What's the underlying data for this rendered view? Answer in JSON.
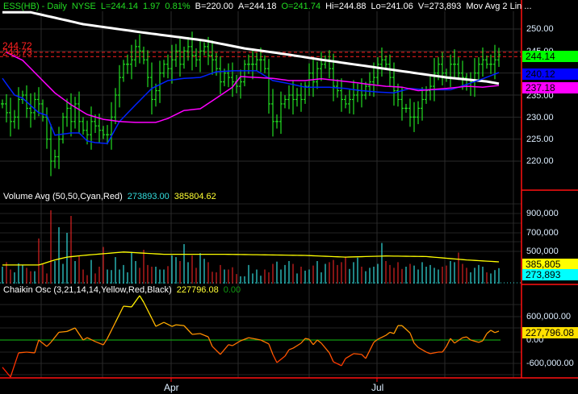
{
  "header": {
    "symbol": "ESS(HB) - Daily",
    "exchange": "NYSE",
    "last": "L=244.14",
    "change": "1.97",
    "change_pct": "0.81%",
    "bid": "B=220.00",
    "ask": "A=244.18",
    "open": "O=241.74",
    "high": "Hi=244.88",
    "low": "Lo=241.06",
    "volume": "V=273,893",
    "studies": "Mov Avg 2 Lin ..."
  },
  "volume_panel": {
    "title": "Volume Avg (50,50,Cyan,Red)",
    "value": "273893.00",
    "avg_value": "385804.62"
  },
  "chaikin_panel": {
    "title": "Chaikin Osc (3,21,14,14,Yellow,Red,Black)",
    "value": "227796.08",
    "signal_value": "0.00"
  },
  "price_axis": {
    "ticks": [
      "250.00",
      "245.00",
      "235.00",
      "230.00",
      "225.00",
      "220.00"
    ]
  },
  "volume_axis": {
    "ticks": [
      "900,000",
      "700,000",
      "500,000"
    ]
  },
  "chaikin_axis": {
    "ticks": [
      "600,000.00",
      "0.00",
      "-600,000.00"
    ]
  },
  "tags": {
    "last": "244.14",
    "ma_blue": "240.12",
    "ma_magenta": "237.18",
    "vol_avg": "385,805",
    "vol": "273,893",
    "chaikin": "227,796.08"
  },
  "ref_lines": {
    "upper": "244.72",
    "lower": "243.73"
  },
  "x_axis": {
    "labels": [
      "Apr",
      "Jul"
    ]
  },
  "colors": {
    "bar": "#22dd22",
    "up_volume": "#33dddd",
    "down_volume": "#dd2222",
    "ma_white": "#ffffff",
    "ma_blue": "#0022ff",
    "ma_magenta": "#ff00ff",
    "ref": "#ff2020",
    "axis": "#ff1010",
    "zero": "#119911",
    "vol_avg": "#ffff00"
  },
  "chart_data": {
    "type": "line",
    "title": "ESS(HB) - Daily NYSE",
    "price_ylim": [
      215,
      254
    ],
    "closes": [
      233,
      231,
      229,
      230,
      234,
      235,
      232,
      231,
      234,
      233,
      230,
      225,
      220,
      221,
      225,
      230,
      232,
      229,
      233,
      229,
      227,
      226,
      229,
      228,
      227,
      226,
      226,
      230,
      235,
      239,
      242,
      242,
      243,
      246,
      245,
      243,
      239,
      234,
      236,
      240,
      242,
      241,
      243,
      245,
      242,
      245,
      246,
      244,
      243,
      245,
      246,
      244,
      243,
      241,
      238,
      240,
      239,
      238,
      237,
      238,
      242,
      242,
      242,
      243,
      243,
      241,
      233,
      229,
      229,
      233,
      234,
      235,
      234,
      235,
      234,
      237,
      240,
      238,
      241,
      242,
      243,
      241,
      237,
      236,
      234,
      233,
      234,
      235,
      236,
      235,
      237,
      238,
      239,
      242,
      243,
      242,
      239,
      236,
      234,
      232,
      232,
      230,
      230,
      232,
      234,
      236,
      237,
      240,
      242,
      240,
      239,
      242,
      242,
      240,
      239,
      237,
      238,
      240,
      242,
      243,
      242,
      242,
      243,
      244.14
    ],
    "ma_white": [
      [
        0,
        253.8
      ],
      [
        7,
        253.8
      ],
      [
        20,
        251.1
      ],
      [
        34,
        249.3
      ],
      [
        50,
        247.4
      ],
      [
        60,
        245.6
      ],
      [
        70,
        244.3
      ],
      [
        80,
        242.9
      ],
      [
        90,
        241.6
      ],
      [
        100,
        240.3
      ],
      [
        110,
        239.0
      ],
      [
        120,
        238.1
      ],
      [
        123,
        237.6
      ]
    ],
    "ma_blue": [
      [
        0,
        238.8
      ],
      [
        3,
        235
      ],
      [
        5,
        234.3
      ],
      [
        9,
        231
      ],
      [
        11,
        230.4
      ],
      [
        13,
        225.9
      ],
      [
        17,
        226.4
      ],
      [
        19,
        226.4
      ],
      [
        21,
        224.6
      ],
      [
        23,
        224.2
      ],
      [
        26,
        224
      ],
      [
        29,
        229
      ],
      [
        33,
        232.8
      ],
      [
        37,
        236.5
      ],
      [
        41,
        238.3
      ],
      [
        45,
        238.8
      ],
      [
        49,
        239
      ],
      [
        53,
        240.3
      ],
      [
        57,
        240.5
      ],
      [
        63,
        240.5
      ],
      [
        67,
        238.3
      ],
      [
        71,
        237.6
      ],
      [
        75,
        236.8
      ],
      [
        81,
        236.8
      ],
      [
        85,
        236.5
      ],
      [
        89,
        236
      ],
      [
        93,
        235.7
      ],
      [
        97,
        235.5
      ],
      [
        101,
        236.5
      ],
      [
        105,
        236.2
      ],
      [
        111,
        236.2
      ],
      [
        115,
        237.4
      ],
      [
        119,
        238.7
      ],
      [
        123,
        240.12
      ]
    ],
    "ma_magenta": [
      [
        1,
        244.7
      ],
      [
        5,
        242.9
      ],
      [
        9,
        239.2
      ],
      [
        13,
        235.5
      ],
      [
        17,
        232.8
      ],
      [
        21,
        230.6
      ],
      [
        25,
        229.5
      ],
      [
        29,
        229
      ],
      [
        33,
        228.8
      ],
      [
        38,
        228.8
      ],
      [
        41,
        229.7
      ],
      [
        45,
        231.5
      ],
      [
        49,
        231.9
      ],
      [
        53,
        234.3
      ],
      [
        57,
        236.8
      ],
      [
        59,
        239.2
      ],
      [
        63,
        239
      ],
      [
        67,
        238.8
      ],
      [
        71,
        238.3
      ],
      [
        75,
        238.3
      ],
      [
        79,
        238.7
      ],
      [
        83,
        238.3
      ],
      [
        87,
        237.9
      ],
      [
        91,
        237.4
      ],
      [
        95,
        237
      ],
      [
        99,
        236.8
      ],
      [
        103,
        236
      ],
      [
        107,
        236.3
      ],
      [
        111,
        236.6
      ],
      [
        115,
        237
      ],
      [
        119,
        236.8
      ],
      [
        123,
        237.18
      ]
    ],
    "volume_thousands": [
      300,
      380,
      250,
      200,
      360,
      330,
      280,
      220,
      220,
      800,
      350,
      180,
      1300,
      400,
      1000,
      350,
      900,
      1200,
      400,
      500,
      250,
      150,
      420,
      180,
      300,
      650,
      250,
      240,
      470,
      250,
      330,
      200,
      560,
      400,
      280,
      600,
      330,
      300,
      300,
      250,
      250,
      310,
      500,
      470,
      400,
      700,
      380,
      500,
      280,
      540,
      440,
      380,
      210,
      200,
      330,
      250,
      250,
      290,
      170,
      130,
      130,
      330,
      180,
      250,
      140,
      250,
      200,
      350,
      390,
      250,
      330,
      400,
      350,
      180,
      300,
      230,
      250,
      320,
      400,
      200,
      350,
      380,
      420,
      330,
      380,
      480,
      260,
      380,
      460,
      300,
      220,
      280,
      300,
      350,
      720,
      400,
      330,
      280,
      380,
      260,
      300,
      350,
      320,
      250,
      380,
      300,
      330,
      280,
      250,
      300,
      320,
      400,
      380,
      550,
      350,
      280,
      200,
      280,
      330,
      300,
      200,
      180,
      240,
      274
    ],
    "volume_avg_thousands": [
      [
        0,
        330
      ],
      [
        9,
        330
      ],
      [
        13,
        420
      ],
      [
        16,
        470
      ],
      [
        20,
        500
      ],
      [
        30,
        560
      ],
      [
        40,
        520
      ],
      [
        55,
        520
      ],
      [
        75,
        500
      ],
      [
        85,
        470
      ],
      [
        95,
        490
      ],
      [
        105,
        480
      ],
      [
        115,
        420
      ],
      [
        123,
        386
      ]
    ],
    "chaikin_thousands": [
      [
        0,
        -700
      ],
      [
        2,
        -950
      ],
      [
        4,
        -330
      ],
      [
        6,
        -310
      ],
      [
        8,
        -330
      ],
      [
        9,
        0
      ],
      [
        11,
        -165
      ],
      [
        12,
        -60
      ],
      [
        14,
        200
      ],
      [
        16,
        220
      ],
      [
        18,
        310
      ],
      [
        20,
        0
      ],
      [
        21,
        60
      ],
      [
        23,
        -40
      ],
      [
        25,
        -124
      ],
      [
        26,
        40
      ],
      [
        28,
        455
      ],
      [
        30,
        870
      ],
      [
        32,
        850
      ],
      [
        34,
        1140
      ],
      [
        35,
        970
      ],
      [
        37,
        560
      ],
      [
        38,
        350
      ],
      [
        40,
        455
      ],
      [
        42,
        350
      ],
      [
        43,
        390
      ],
      [
        45,
        370
      ],
      [
        47,
        145
      ],
      [
        49,
        165
      ],
      [
        51,
        80
      ],
      [
        52,
        -165
      ],
      [
        54,
        -370
      ],
      [
        56,
        -120
      ],
      [
        57,
        -145
      ],
      [
        59,
        -20
      ],
      [
        61,
        60
      ],
      [
        63,
        20
      ],
      [
        64,
        0
      ],
      [
        66,
        -100
      ],
      [
        67,
        -370
      ],
      [
        68,
        -580
      ],
      [
        70,
        -415
      ],
      [
        71,
        -250
      ],
      [
        72,
        -210
      ],
      [
        74,
        -80
      ],
      [
        75,
        40
      ],
      [
        76,
        20
      ],
      [
        77,
        -120
      ],
      [
        78,
        0
      ],
      [
        79,
        -80
      ],
      [
        81,
        -330
      ],
      [
        82,
        -560
      ],
      [
        84,
        -660
      ],
      [
        85,
        -475
      ],
      [
        87,
        -350
      ],
      [
        89,
        -370
      ],
      [
        90,
        -475
      ],
      [
        92,
        -60
      ],
      [
        93,
        20
      ],
      [
        95,
        120
      ],
      [
        96,
        200
      ],
      [
        97,
        165
      ],
      [
        98,
        370
      ],
      [
        99,
        370
      ],
      [
        101,
        180
      ],
      [
        102,
        -80
      ],
      [
        103,
        -190
      ],
      [
        105,
        -310
      ],
      [
        106,
        -350
      ],
      [
        108,
        -310
      ],
      [
        109,
        -310
      ],
      [
        110,
        -165
      ],
      [
        111,
        40
      ],
      [
        112,
        -80
      ],
      [
        114,
        60
      ],
      [
        115,
        80
      ],
      [
        116,
        0
      ],
      [
        118,
        -60
      ],
      [
        119,
        -20
      ],
      [
        120,
        165
      ],
      [
        121,
        250
      ],
      [
        122,
        190
      ],
      [
        123,
        228
      ]
    ]
  }
}
